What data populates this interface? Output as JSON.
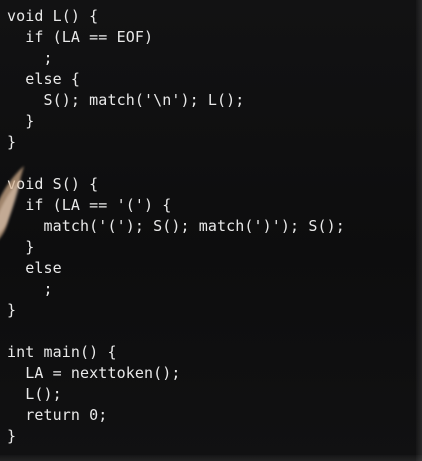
{
  "code_lines": [
    "void L() {",
    "  if (LA == EOF)",
    "    ;",
    "  else {",
    "    S(); match('\\n'); L();",
    "  }",
    "}",
    "",
    "void S() {",
    "  if (LA == '(') {",
    "    match('('); S(); match(')'); S();",
    "  }",
    "  else",
    "    ;",
    "}",
    "",
    "int main() {",
    "  LA = nexttoken();",
    "  L();",
    "  return 0;",
    "}"
  ]
}
